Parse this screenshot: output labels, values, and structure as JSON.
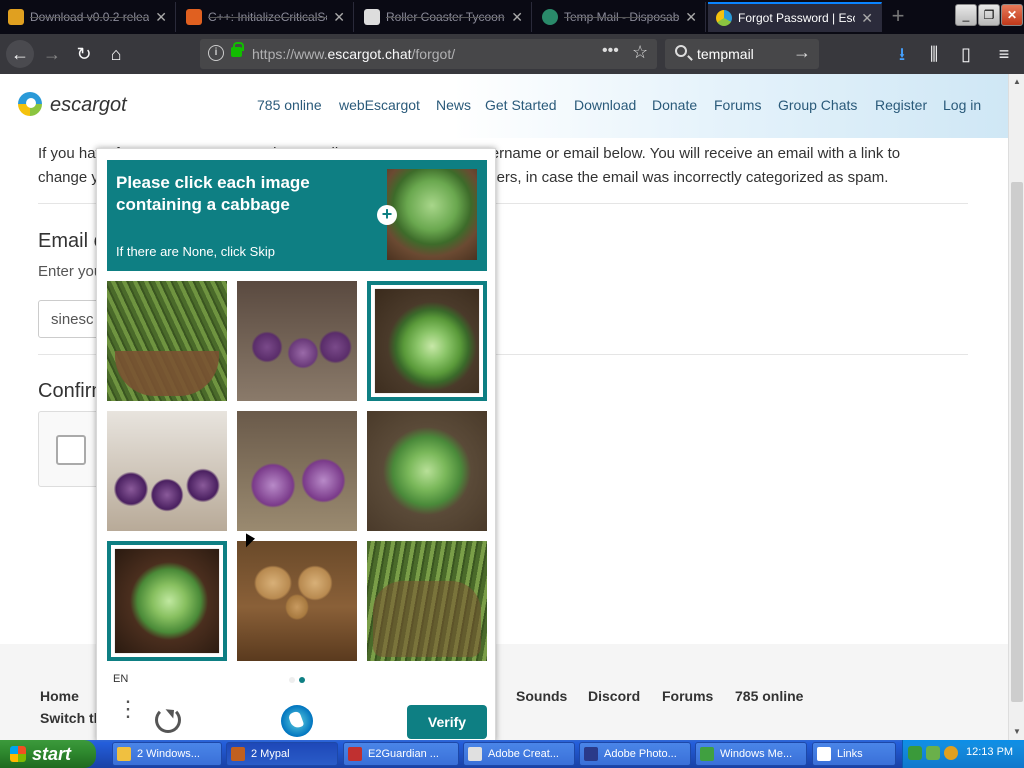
{
  "browser": {
    "tabs": [
      {
        "label": "Download v0.0.2 relea",
        "icon_color": "#e0a020",
        "active": false
      },
      {
        "label": "C++: InitializeCriticalSe",
        "icon_color": "#e06020",
        "active": false
      },
      {
        "label": "Roller Coaster Tycoon",
        "icon_color": "#dddddd",
        "active": false
      },
      {
        "label": "Temp Mail - Disposable",
        "icon_color": "#2a8a6a",
        "active": false
      },
      {
        "label": "Forgot Password | Escar",
        "icon_color": "#f4c20d",
        "active": true
      }
    ],
    "new_tab_label": "+",
    "url_prefix": "https://www.",
    "url_domain": "escargot.chat",
    "url_path": "/forgot/",
    "search_query": "tempmail",
    "window_controls": {
      "minimize": "_",
      "restore": "❐",
      "close": "✕"
    }
  },
  "site": {
    "logo_text": "escargot",
    "nav": [
      "785 online",
      "webEscargot",
      "News",
      "Get Started",
      "Download",
      "Donate",
      "Forums",
      "Group Chats",
      "Register",
      "Log in"
    ],
    "intro_line1": "If you have forgotten your password, or email, you can enter your username or email below. You will receive an email with a link to",
    "intro_line2": "change your password. Please check your spam and other email folders, in case the email was incorrectly categorized as spam.",
    "email_heading": "Email or username",
    "enter_text": "Enter your email or username",
    "email_value": "sinesc",
    "confirm_heading": "Confirm",
    "footer_left": [
      "Home",
      "Switch theme"
    ],
    "footer_right": [
      "Sounds",
      "Discord",
      "Forums",
      "785 online"
    ]
  },
  "captcha": {
    "prompt": "Please click each image containing a cabbage",
    "subprompt": "If there are None, click Skip",
    "example_subject": "cabbage",
    "grid": [
      {
        "subject": "asparagus",
        "selected": false
      },
      {
        "subject": "onion",
        "selected": false
      },
      {
        "subject": "cabbage",
        "selected": true
      },
      {
        "subject": "onion",
        "selected": false
      },
      {
        "subject": "onion",
        "selected": false
      },
      {
        "subject": "cabbage",
        "selected": false
      },
      {
        "subject": "cabbage",
        "selected": true
      },
      {
        "subject": "potato",
        "selected": false
      },
      {
        "subject": "asparagus",
        "selected": false
      }
    ],
    "language": "EN",
    "verify_label": "Verify",
    "accent_color": "#0e7f83",
    "page_indicator": {
      "current": 2,
      "total": 2
    }
  },
  "taskbar": {
    "start_label": "start",
    "tasks": [
      {
        "label": "2 Windows...",
        "icon_color": "#f0c040"
      },
      {
        "label": "2 Mypal",
        "icon_color": "#c06020"
      },
      {
        "label": "E2Guardian ...",
        "icon_color": "#c03030"
      },
      {
        "label": "Adobe Creat...",
        "icon_color": "#e0e0e0"
      },
      {
        "label": "Adobe Photo...",
        "icon_color": "#2a3a8a"
      },
      {
        "label": "Windows Me...",
        "icon_color": "#40a040"
      },
      {
        "label": "Links",
        "icon_color": "#ffffff"
      }
    ],
    "clock": "12:13 PM"
  }
}
